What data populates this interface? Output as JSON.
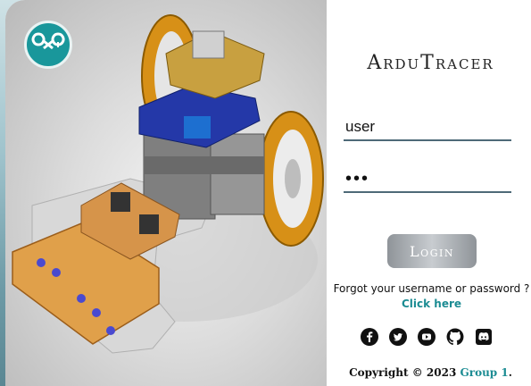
{
  "app": {
    "title": "ArduTracer"
  },
  "login": {
    "username_value": "user",
    "password_value": "•••",
    "button_label": "Login"
  },
  "help": {
    "forgot_text": "Forgot your username or password ?",
    "link_text": "Click here"
  },
  "social": {
    "icons": [
      "facebook-icon",
      "twitter-icon",
      "youtube-icon",
      "github-icon",
      "discord-icon"
    ]
  },
  "footer": {
    "copyright_prefix": "Copyright © 2023",
    "group_name": "Group 1",
    "period": "."
  },
  "colors": {
    "accent": "#1c8c93",
    "badge": "#19979b"
  }
}
